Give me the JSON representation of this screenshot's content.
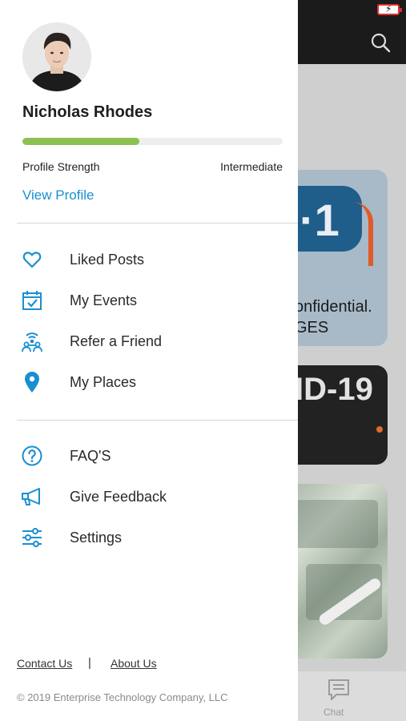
{
  "theme": {
    "accent": "#1a8fd0",
    "progress_fill": "#8cc152",
    "progress_track": "#eeeeee",
    "icon_color": "#1a8fd0"
  },
  "profile": {
    "name": "Nicholas Rhodes",
    "strength_label": "Profile Strength",
    "strength_level": "Intermediate",
    "strength_fraction": 0.45,
    "view_profile_label": "View Profile"
  },
  "menu_primary": [
    {
      "label": "Liked Posts",
      "icon": "heart-icon"
    },
    {
      "label": "My Events",
      "icon": "calendar-check-icon"
    },
    {
      "label": "Refer a Friend",
      "icon": "refer-friend-icon"
    },
    {
      "label": "My Places",
      "icon": "location-pin-icon"
    }
  ],
  "menu_secondary": [
    {
      "label": "FAQ'S",
      "icon": "question-circle-icon"
    },
    {
      "label": "Give Feedback",
      "icon": "megaphone-icon"
    },
    {
      "label": "Settings",
      "icon": "sliders-icon"
    }
  ],
  "footer": {
    "contact_label": "Contact Us",
    "separator": "|",
    "about_label": "About Us",
    "copyright": "© 2019 Enterprise Technology Company, LLC"
  },
  "background": {
    "card1_number": "·1",
    "card1_line1": "onfidential.",
    "card1_line2": "GES",
    "card2_text": "ID-19",
    "tab_chat_label": "Chat"
  }
}
